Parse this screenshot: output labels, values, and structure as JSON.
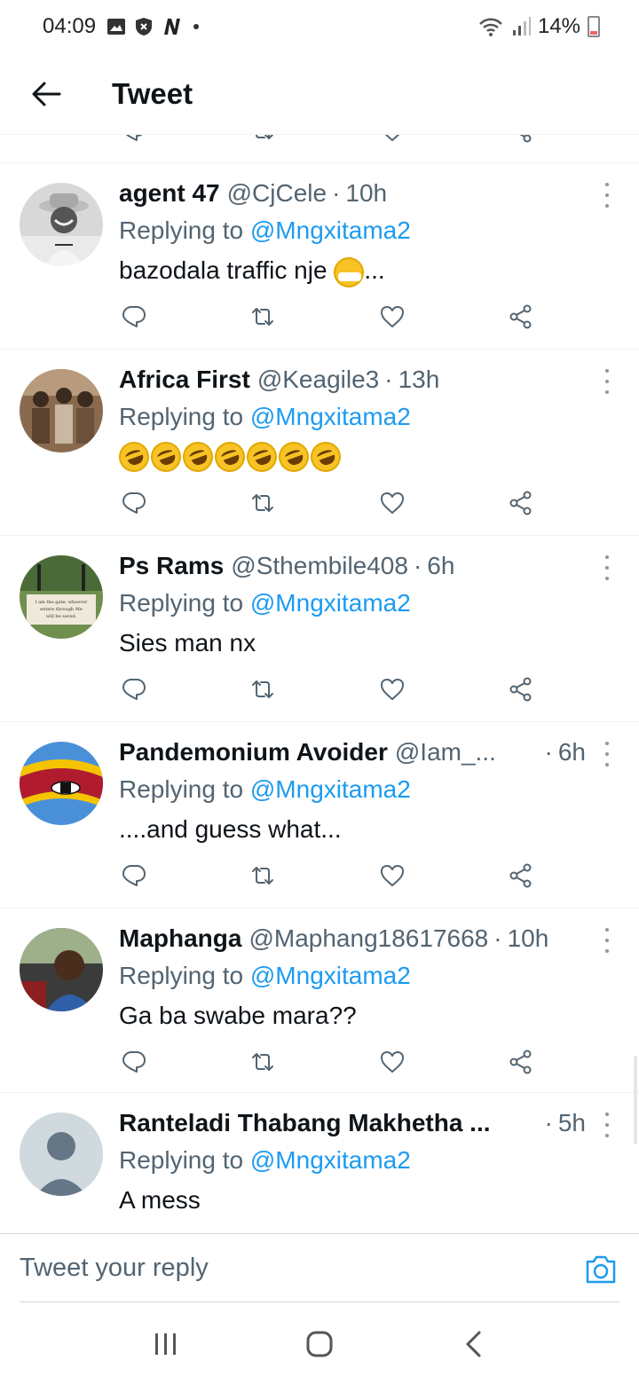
{
  "status_bar": {
    "time": "04:09",
    "battery": "14%"
  },
  "header": {
    "title": "Tweet"
  },
  "tweets": [
    {
      "name": "agent 47",
      "handle": "@CjCele",
      "time": "10h",
      "replying_prefix": "Replying to",
      "replying_to": "@Mngxitama2",
      "text": "bazodala traffic nje",
      "text_suffix": "..."
    },
    {
      "name": "Africa First",
      "handle": "@Keagile3",
      "time": "13h",
      "replying_prefix": "Replying to",
      "replying_to": "@Mngxitama2",
      "text": ""
    },
    {
      "name": "Ps Rams",
      "handle": "@Sthembile408",
      "time": "6h",
      "replying_prefix": "Replying to",
      "replying_to": "@Mngxitama2",
      "text": "Sies man nx",
      "avatar_caption": "I am the gate; whoever enters through Me will be saved."
    },
    {
      "name": "Pandemonium Avoider",
      "handle": "@Iam_...",
      "time": "6h",
      "replying_prefix": "Replying to",
      "replying_to": "@Mngxitama2",
      "text": "....and guess what..."
    },
    {
      "name": "Maphanga",
      "handle": "@Maphang18617668",
      "time": "10h",
      "replying_prefix": "Replying to",
      "replying_to": "@Mngxitama2",
      "text": "Ga ba swabe mara??"
    },
    {
      "name": "Ranteladi Thabang Makhetha ...",
      "handle": "",
      "time": "5h",
      "replying_prefix": "Replying to",
      "replying_to": "@Mngxitama2",
      "text": "A mess"
    }
  ],
  "composer": {
    "placeholder": "Tweet your reply"
  },
  "icons": {
    "back": "arrow-left-icon",
    "reply": "reply-icon",
    "retweet": "retweet-icon",
    "like": "heart-icon",
    "share": "share-icon",
    "more": "more-vertical-icon",
    "camera": "camera-icon"
  },
  "colors": {
    "accent": "#1d9bf0",
    "secondary_text": "#536471",
    "divider": "#eff3f4"
  }
}
